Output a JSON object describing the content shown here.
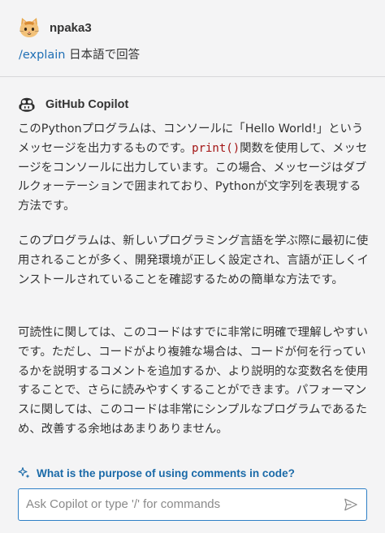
{
  "user_message": {
    "username": "npaka3",
    "avatar_icon": "cat-avatar-icon",
    "command": "/explain",
    "text": " 日本語で回答"
  },
  "copilot_response": {
    "name": "GitHub Copilot",
    "icon": "copilot-icon",
    "paragraph_1": {
      "before_code": "このPythonプログラムは、コンソールに「Hello World!」というメッセージを出力するものです。",
      "code": "print()",
      "after_code": "関数を使用して、メッセージをコンソールに出力しています。この場合、メッセージはダブルクォーテーションで囲まれており、Pythonが文字列を表現する方法です。"
    },
    "paragraph_2": "このプログラムは、新しいプログラミング言語を学ぶ際に最初に使用されることが多く、開発環境が正しく設定され、言語が正しくインストールされていることを確認するための簡単な方法です。",
    "paragraph_3": "可読性に関しては、このコードはすでに非常に明確で理解しやすいです。ただし、コードがより複雑な場合は、コードが何を行っているかを説明するコメントを追加するか、より説明的な変数名を使用することで、さらに読みやすくすることができます。パフォーマンスに関しては、このコードは非常にシンプルなプログラムであるため、改善する余地はあまりありません。"
  },
  "suggestion": {
    "icon": "sparkle-icon",
    "text": "What is the purpose of using comments in code?"
  },
  "chat_input": {
    "value": "",
    "placeholder": "Ask Copilot or type '/' for commands",
    "send_icon": "send-icon"
  },
  "colors": {
    "background": "#f4f4f5",
    "link": "#1f6fb5",
    "suggestion": "#1a6aa8",
    "input_border": "#2d7fc6",
    "code": "#a31515"
  }
}
